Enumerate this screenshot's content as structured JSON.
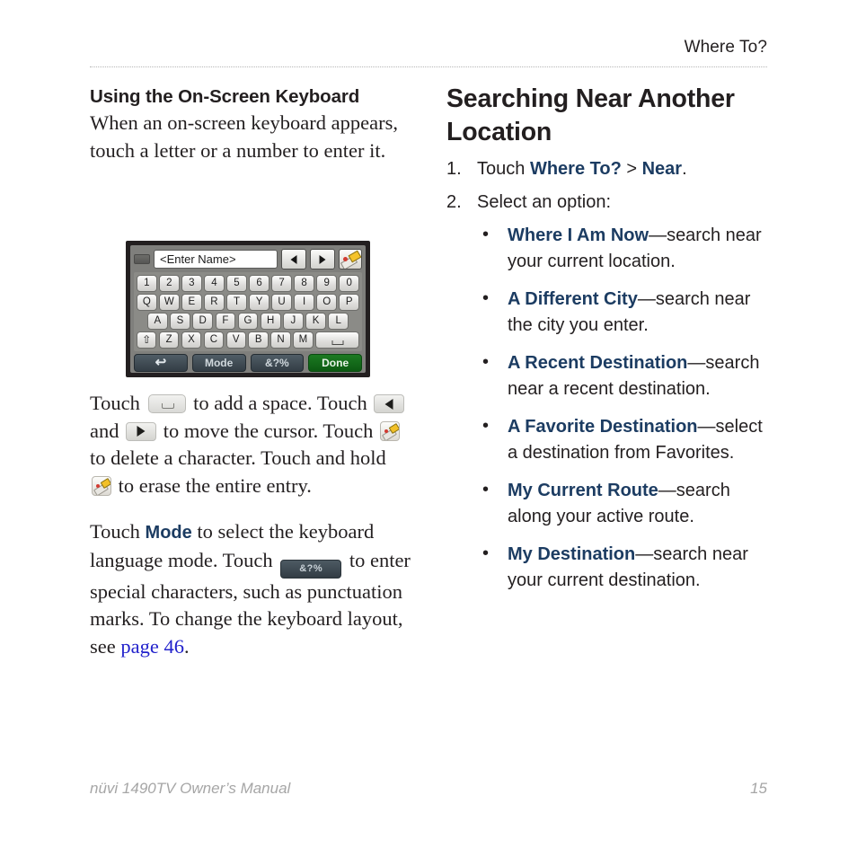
{
  "header": {
    "title": "Where To?"
  },
  "left_column": {
    "heading": "Using the On-Screen Keyboard",
    "intro": "When an on-screen keyboard appears, touch a letter or a number to enter it.",
    "para2": {
      "t1": "Touch ",
      "t2": " to add a space. Touch ",
      "t3": " and ",
      "t4": " to move the cursor. Touch ",
      "t5": " to delete a character. Touch and hold ",
      "t6": " to erase the entire entry."
    },
    "para3": {
      "t1": "Touch ",
      "mode": "Mode",
      "t2": " to select the keyboard language mode. Touch ",
      "symbols_chip": "&?%",
      "t3": " to enter special characters, such as punctuation marks. To change the keyboard layout, see ",
      "link": "page 46",
      "t4": "."
    }
  },
  "keyboard_figure": {
    "entry_placeholder": "<Enter Name>",
    "row_numbers": [
      "1",
      "2",
      "3",
      "4",
      "5",
      "6",
      "7",
      "8",
      "9",
      "0"
    ],
    "row_top": [
      "Q",
      "W",
      "E",
      "R",
      "T",
      "Y",
      "U",
      "I",
      "O",
      "P"
    ],
    "row_home": [
      "A",
      "S",
      "D",
      "F",
      "G",
      "H",
      "J",
      "K",
      "L"
    ],
    "row_bottom": [
      "Z",
      "X",
      "C",
      "V",
      "B",
      "N",
      "M"
    ],
    "shift_key": "shift-icon",
    "space_key": "space-icon",
    "nav_left": "arrow-left-icon",
    "nav_right": "arrow-right-icon",
    "erase_key": "eraser-icon",
    "buttons": {
      "back": "back-arrow-icon",
      "mode": "Mode",
      "symbols": "&?%",
      "done": "Done"
    }
  },
  "right_column": {
    "heading": "Searching Near Another Location",
    "steps": [
      {
        "num": "1.",
        "pre": "Touch ",
        "bold1": "Where To?",
        "mid": " > ",
        "bold2": "Near",
        "post": "."
      },
      {
        "num": "2.",
        "pre": "Select an option:",
        "bold1": "",
        "mid": "",
        "bold2": "",
        "post": ""
      }
    ],
    "options": [
      {
        "bullet": "•",
        "name": "Where I Am Now",
        "desc": "—search near your current location."
      },
      {
        "bullet": "•",
        "name": "A Different City",
        "desc": "—search near the city you enter."
      },
      {
        "bullet": "•",
        "name": "A Recent Destination",
        "desc": "—search near a recent destination."
      },
      {
        "bullet": "•",
        "name": "A Favorite Destination",
        "desc": "—select a destination from Favorites."
      },
      {
        "bullet": "•",
        "name": "My Current Route",
        "desc": "—search along your active route."
      },
      {
        "bullet": "•",
        "name": "My Destination",
        "desc": "—search near your current destination."
      }
    ]
  },
  "footer": {
    "manual": "nüvi 1490TV Owner’s Manual",
    "page_number": "15"
  },
  "colors": {
    "bold_blue": "#1c3c62",
    "link_blue": "#2222cc",
    "text": "#231f20",
    "footer_gray": "#a6a6a6"
  }
}
